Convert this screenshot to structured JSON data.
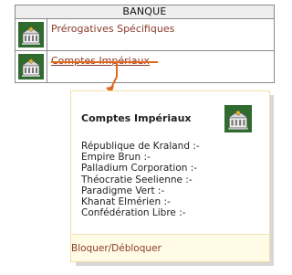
{
  "panel": {
    "header": "BANQUE",
    "rows": [
      {
        "label": "Prérogatives Spécifiques",
        "icon": "bank-building-icon"
      },
      {
        "label": "Comptes Impériaux",
        "icon": "bank-building-icon"
      }
    ]
  },
  "popup": {
    "title": "Comptes Impériaux",
    "icon": "bank-building-icon",
    "accounts": [
      "République de Kraland :-",
      "Empire Brun :-",
      "Palladium Corporation :-",
      "Théocratie Seelienne :-",
      "Paradigme Vert :-",
      "Khanat Elmérien :-",
      "Confédération Libre :-"
    ],
    "footer_link": "Bloquer/Débloquer"
  },
  "colors": {
    "accent": "#e26a1e",
    "link": "#8b3b2b",
    "popup_bg": "#fffbe4",
    "icon_green": "#2f6b2f"
  }
}
